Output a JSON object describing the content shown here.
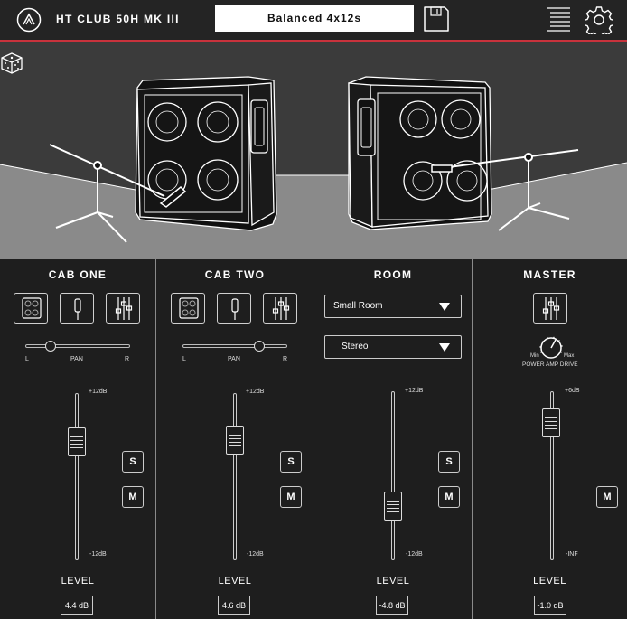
{
  "header": {
    "product_name": "HT CLUB 50H MK III",
    "preset_name": "Balanced 4x12s"
  },
  "colors": {
    "accent": "#c8323c",
    "background": "#1e1e1e",
    "stage": "#3b3b3b"
  },
  "icons": [
    "logo-icon",
    "save-icon",
    "menu-icon",
    "gear-icon",
    "dice-icon",
    "cabinet-icon",
    "microphone-icon",
    "mixer-settings-icon"
  ],
  "strips": [
    {
      "title": "CAB ONE",
      "pan": {
        "left": "L",
        "label": "PAN",
        "right": "R",
        "value": 0.25
      },
      "fader": {
        "max_label": "+12dB",
        "min_label": "-12dB"
      },
      "solo": "S",
      "mute": "M",
      "level_label": "LEVEL",
      "level_value": "4.4 dB"
    },
    {
      "title": "CAB TWO",
      "pan": {
        "left": "L",
        "label": "PAN",
        "right": "R",
        "value": 0.75
      },
      "fader": {
        "max_label": "+12dB",
        "min_label": "-12dB"
      },
      "solo": "S",
      "mute": "M",
      "level_label": "LEVEL",
      "level_value": "4.6 dB"
    },
    {
      "title": "ROOM",
      "room_select": "Small Room",
      "mode_select": "Stereo",
      "fader": {
        "max_label": "+12dB",
        "min_label": "-12dB"
      },
      "solo": "S",
      "mute": "M",
      "level_label": "LEVEL",
      "level_value": "-4.8 dB"
    },
    {
      "title": "MASTER",
      "drive": {
        "min": "Min",
        "max": "Max",
        "label": "POWER AMP DRIVE"
      },
      "fader": {
        "max_label": "+6dB",
        "min_label": "-INF"
      },
      "mute": "M",
      "level_label": "LEVEL",
      "level_value": "-1.0 dB"
    }
  ]
}
